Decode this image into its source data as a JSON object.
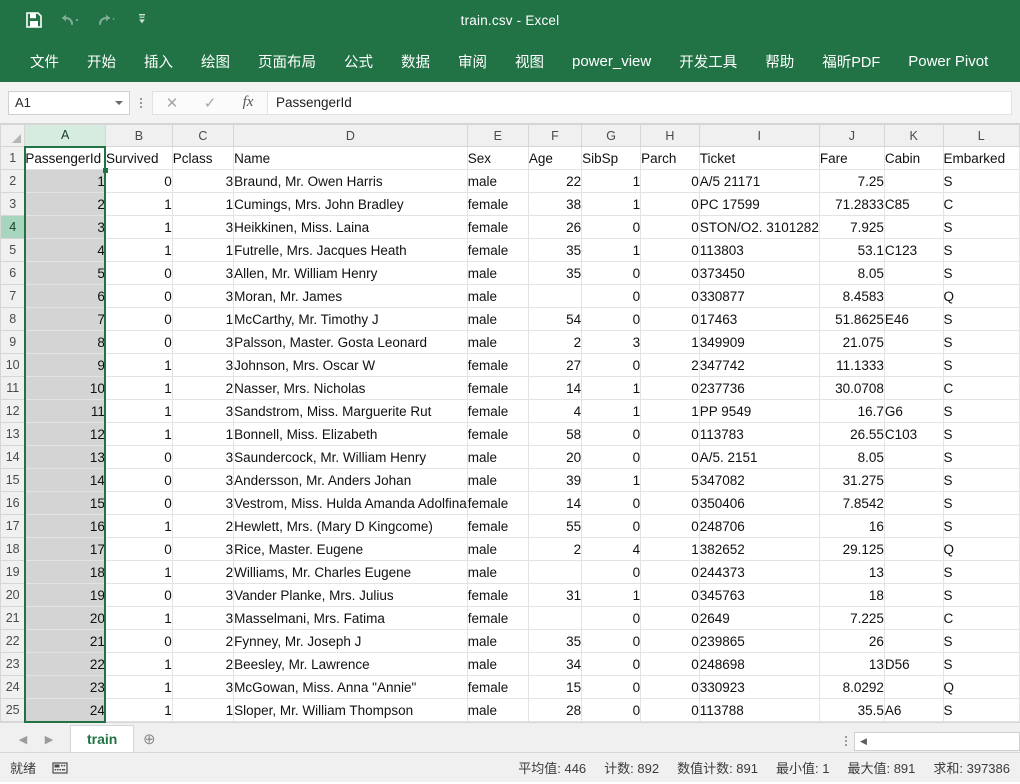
{
  "window": {
    "title": "train.csv  -  Excel"
  },
  "quick_access": {
    "buttons": [
      {
        "name": "save-icon",
        "label": "保存"
      },
      {
        "name": "undo-icon",
        "label": "撤销"
      },
      {
        "name": "redo-icon",
        "label": "恢复"
      },
      {
        "name": "customize-qat-icon",
        "label": "自定义快速访问工具栏"
      }
    ]
  },
  "ribbon": {
    "tabs": [
      "文件",
      "开始",
      "插入",
      "绘图",
      "页面布局",
      "公式",
      "数据",
      "审阅",
      "视图",
      "power_view",
      "开发工具",
      "帮助",
      "福昕PDF",
      "Power Pivot"
    ]
  },
  "formula_bar": {
    "name_box": "A1",
    "cancel_icon": "✕",
    "confirm_icon": "✓",
    "fx_icon": "fx",
    "value": "PassengerId"
  },
  "grid": {
    "column_letters": [
      "A",
      "B",
      "C",
      "D",
      "E",
      "F",
      "G",
      "H",
      "I",
      "J",
      "K",
      "L"
    ],
    "selected_column": "A",
    "row_numbers": [
      1,
      2,
      3,
      4,
      5,
      6,
      7,
      8,
      9,
      10,
      11,
      12,
      13,
      14,
      15,
      16,
      17,
      18,
      19,
      20,
      21,
      22,
      23,
      24,
      25
    ],
    "headers": [
      "PassengerId",
      "Survived",
      "Pclass",
      "Name",
      "Sex",
      "Age",
      "SibSp",
      "Parch",
      "Ticket",
      "Fare",
      "Cabin",
      "Embarked"
    ],
    "rows": [
      [
        "1",
        "0",
        "3",
        "Braund, Mr. Owen Harris",
        "male",
        "22",
        "1",
        "0",
        "A/5 21171",
        "7.25",
        "",
        "S"
      ],
      [
        "2",
        "1",
        "1",
        "Cumings, Mrs. John Bradley",
        "female",
        "38",
        "1",
        "0",
        "PC 17599",
        "71.2833",
        "C85",
        "C"
      ],
      [
        "3",
        "1",
        "3",
        "Heikkinen, Miss. Laina",
        "female",
        "26",
        "0",
        "0",
        "STON/O2. 3101282",
        "7.925",
        "",
        "S"
      ],
      [
        "4",
        "1",
        "1",
        "Futrelle, Mrs. Jacques Heath",
        "female",
        "35",
        "1",
        "0",
        "113803",
        "53.1",
        "C123",
        "S"
      ],
      [
        "5",
        "0",
        "3",
        "Allen, Mr. William Henry",
        "male",
        "35",
        "0",
        "0",
        "373450",
        "8.05",
        "",
        "S"
      ],
      [
        "6",
        "0",
        "3",
        "Moran, Mr. James",
        "male",
        "",
        "0",
        "0",
        "330877",
        "8.4583",
        "",
        "Q"
      ],
      [
        "7",
        "0",
        "1",
        "McCarthy, Mr. Timothy J",
        "male",
        "54",
        "0",
        "0",
        "17463",
        "51.8625",
        "E46",
        "S"
      ],
      [
        "8",
        "0",
        "3",
        "Palsson, Master. Gosta Leonard",
        "male",
        "2",
        "3",
        "1",
        "349909",
        "21.075",
        "",
        "S"
      ],
      [
        "9",
        "1",
        "3",
        "Johnson, Mrs. Oscar W",
        "female",
        "27",
        "0",
        "2",
        "347742",
        "11.1333",
        "",
        "S"
      ],
      [
        "10",
        "1",
        "2",
        "Nasser, Mrs. Nicholas",
        "female",
        "14",
        "1",
        "0",
        "237736",
        "30.0708",
        "",
        "C"
      ],
      [
        "11",
        "1",
        "3",
        "Sandstrom, Miss. Marguerite Rut",
        "female",
        "4",
        "1",
        "1",
        "PP 9549",
        "16.7",
        "G6",
        "S"
      ],
      [
        "12",
        "1",
        "1",
        "Bonnell, Miss. Elizabeth",
        "female",
        "58",
        "0",
        "0",
        "113783",
        "26.55",
        "C103",
        "S"
      ],
      [
        "13",
        "0",
        "3",
        "Saundercock, Mr. William Henry",
        "male",
        "20",
        "0",
        "0",
        "A/5. 2151",
        "8.05",
        "",
        "S"
      ],
      [
        "14",
        "0",
        "3",
        "Andersson, Mr. Anders Johan",
        "male",
        "39",
        "1",
        "5",
        "347082",
        "31.275",
        "",
        "S"
      ],
      [
        "15",
        "0",
        "3",
        "Vestrom, Miss. Hulda Amanda Adolfina",
        "female",
        "14",
        "0",
        "0",
        "350406",
        "7.8542",
        "",
        "S"
      ],
      [
        "16",
        "1",
        "2",
        "Hewlett, Mrs. (Mary D Kingcome)",
        "female",
        "55",
        "0",
        "0",
        "248706",
        "16",
        "",
        "S"
      ],
      [
        "17",
        "0",
        "3",
        "Rice, Master. Eugene",
        "male",
        "2",
        "4",
        "1",
        "382652",
        "29.125",
        "",
        "Q"
      ],
      [
        "18",
        "1",
        "2",
        "Williams, Mr. Charles Eugene",
        "male",
        "",
        "0",
        "0",
        "244373",
        "13",
        "",
        "S"
      ],
      [
        "19",
        "0",
        "3",
        "Vander Planke, Mrs. Julius",
        "female",
        "31",
        "1",
        "0",
        "345763",
        "18",
        "",
        "S"
      ],
      [
        "20",
        "1",
        "3",
        "Masselmani, Mrs. Fatima",
        "female",
        "",
        "0",
        "0",
        "2649",
        "7.225",
        "",
        "C"
      ],
      [
        "21",
        "0",
        "2",
        "Fynney, Mr. Joseph J",
        "male",
        "35",
        "0",
        "0",
        "239865",
        "26",
        "",
        "S"
      ],
      [
        "22",
        "1",
        "2",
        "Beesley, Mr. Lawrence",
        "male",
        "34",
        "0",
        "0",
        "248698",
        "13",
        "D56",
        "S"
      ],
      [
        "23",
        "1",
        "3",
        "McGowan, Miss. Anna \"Annie\"",
        "female",
        "15",
        "0",
        "0",
        "330923",
        "8.0292",
        "",
        "Q"
      ],
      [
        "24",
        "1",
        "1",
        "Sloper, Mr. William Thompson",
        "male",
        "28",
        "0",
        "0",
        "113788",
        "35.5",
        "A6",
        "S"
      ]
    ]
  },
  "sheet_bar": {
    "prev_icon": "◀",
    "next_icon": "▶",
    "tabs": [
      "train"
    ],
    "add_sheet_icon": "⊕",
    "scroll_left_icon": "◀"
  },
  "status_bar": {
    "mode": "就绪",
    "record_macro_icon": "record-macro-icon",
    "stats": [
      "平均值: 446",
      "计数: 892",
      "数值计数: 891",
      "最小值: 1",
      "最大值: 891",
      "求和: 397386"
    ]
  },
  "colors": {
    "excel_green": "#217346",
    "selection_green": "#217346",
    "header_gray": "#f0f0f0",
    "selected_col_fill": "#d4d4d4"
  }
}
